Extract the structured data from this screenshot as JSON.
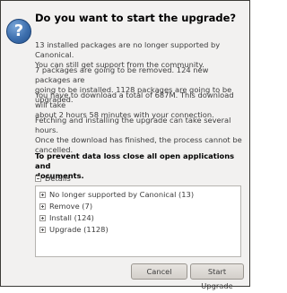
{
  "dialog": {
    "heading": "Do you want to start the upgrade?",
    "icon": "question-icon",
    "icon_glyph": "?",
    "paragraphs": [
      [
        "13 installed packages are no longer supported by Canonical.",
        "You can still get support from the community."
      ],
      [
        "7 packages are going to be removed. 124 new packages are",
        "going to be installed. 1128 packages are going to be upgraded."
      ],
      [
        "You have to download a total of 687M. This download will take",
        "about 2 hours 58 minutes with your connection."
      ],
      [
        "Fetching and installing the upgrade can take several hours.",
        "Once the download has finished, the process cannot be",
        "cancelled."
      ]
    ],
    "warning": [
      "To prevent data loss close all open applications and",
      "documents."
    ],
    "details_label": "Details",
    "details_items": [
      "No longer supported by Canonical (13)",
      "Remove (7)",
      "Install (124)",
      "Upgrade (1128)"
    ],
    "buttons": {
      "cancel": "Cancel",
      "start": "Start Upgrade"
    }
  }
}
